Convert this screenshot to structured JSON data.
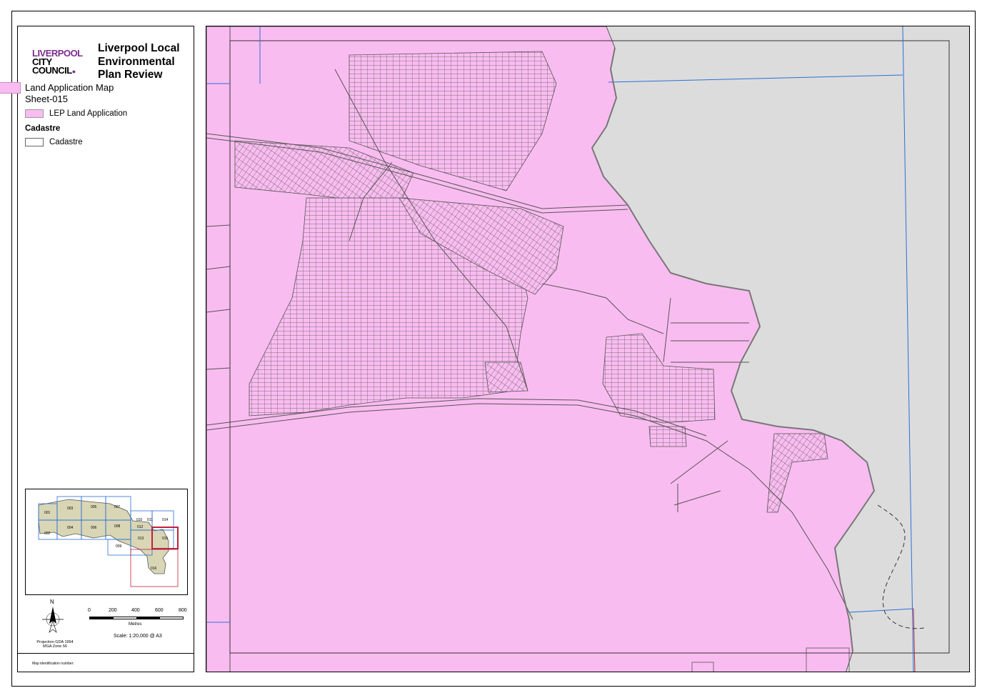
{
  "logo": {
    "line1": "LIVERPOOL",
    "line2": "CITY",
    "line3": "COUNCIL",
    "mark": "●"
  },
  "title": "Liverpool Local Environmental Plan Review",
  "map_name": "Land Application Map",
  "sheet_id": "Sheet-015",
  "legend": {
    "items": [
      {
        "label": "LEP Land Application",
        "fill": "#f9bcf0",
        "stroke": "#9a9a9a"
      }
    ],
    "cadastre_heading": "Cadastre",
    "cadastre_item": {
      "label": "Cadastre",
      "fill": "#ffffff",
      "stroke": "#666666"
    }
  },
  "inset_map": {
    "sheets": [
      "001",
      "002",
      "003",
      "004",
      "005",
      "006",
      "007",
      "008",
      "009",
      "010",
      "011",
      "012",
      "013",
      "014",
      "015",
      "016"
    ],
    "current_sheet": "015"
  },
  "north_arrow": {
    "label": "N"
  },
  "scale": {
    "ticks": [
      "0",
      "200",
      "400",
      "600",
      "800"
    ],
    "units": "Metres",
    "text": "Scale: 1:20,000 @ A3"
  },
  "projection": {
    "line1": "Projection GDA 1994",
    "line2": "MGA Zone 56"
  },
  "map_id_label": "Map identification number:",
  "colors": {
    "land_application": "#f9bcf0",
    "background_land": "#dcdcdc",
    "parcel_line": "#555555",
    "grid_line": "#2b6fd6",
    "inset_highlight": "#c0203a",
    "logo_accent": "#7b2e8c"
  }
}
